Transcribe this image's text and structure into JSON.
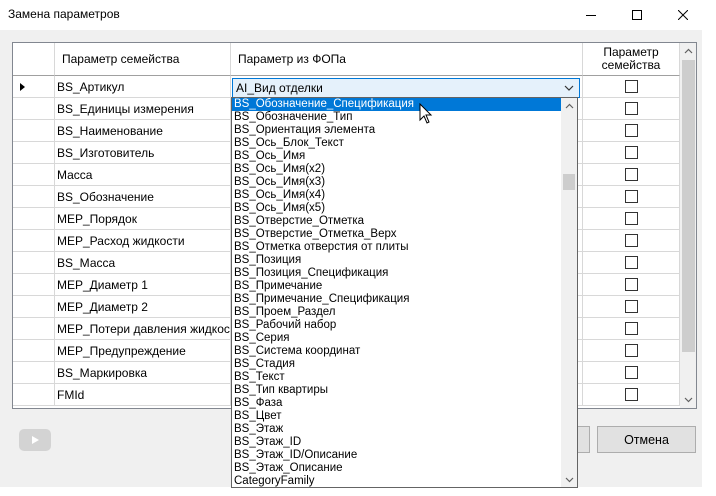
{
  "window": {
    "title": "Замена параметров"
  },
  "grid": {
    "columns": [
      "Параметр семейства",
      "Параметр из ФОПа",
      "Параметр\nсемейства"
    ],
    "rows": [
      {
        "name": "BS_Артикул",
        "fop": "AI_Вид отделки",
        "checked": false
      },
      {
        "name": "BS_Единицы измерения",
        "fop": "",
        "checked": false
      },
      {
        "name": "BS_Наименование",
        "fop": "",
        "checked": false
      },
      {
        "name": "BS_Изготовитель",
        "fop": "",
        "checked": false
      },
      {
        "name": "Масса",
        "fop": "",
        "checked": false
      },
      {
        "name": "BS_Обозначение",
        "fop": "",
        "checked": false
      },
      {
        "name": "MEP_Порядок",
        "fop": "",
        "checked": false
      },
      {
        "name": "MEP_Расход жидкости",
        "fop": "",
        "checked": false
      },
      {
        "name": "BS_Масса",
        "fop": "",
        "checked": false
      },
      {
        "name": "MEP_Диаметр 1",
        "fop": "",
        "checked": false
      },
      {
        "name": "MEP_Диаметр 2",
        "fop": "",
        "checked": false
      },
      {
        "name": "MEP_Потери давления жидкости",
        "fop": "",
        "checked": false
      },
      {
        "name": "MEP_Предупреждение",
        "fop": "",
        "checked": false
      },
      {
        "name": "BS_Маркировка",
        "fop": "",
        "checked": false
      },
      {
        "name": "FMId",
        "fop": "",
        "checked": false
      }
    ]
  },
  "combo": {
    "value": "AI_Вид отделки"
  },
  "dropdown": {
    "selected_index": 0,
    "items": [
      "BS_Обозначение_Спецификация",
      "BS_Обозначение_Тип",
      "BS_Ориентация элемента",
      "BS_Ось_Блок_Текст",
      "BS_Ось_Имя",
      "BS_Ось_Имя(x2)",
      "BS_Ось_Имя(x3)",
      "BS_Ось_Имя(x4)",
      "BS_Ось_Имя(x5)",
      "BS_Отверстие_Отметка",
      "BS_Отверстие_Отметка_Верх",
      "BS_Отметка отверстия от плиты",
      "BS_Позиция",
      "BS_Позиция_Спецификация",
      "BS_Примечание",
      "BS_Примечание_Спецификация",
      "BS_Проем_Раздел",
      "BS_Рабочий набор",
      "BS_Серия",
      "BS_Система координат",
      "BS_Стадия",
      "BS_Текст",
      "BS_Тип квартиры",
      "BS_Фаза",
      "BS_Цвет",
      "BS_Этаж",
      "BS_Этаж_ID",
      "BS_Этаж_ID/Описание",
      "BS_Этаж_Описание",
      "CategoryFamily"
    ]
  },
  "buttons": {
    "cancel_label": "Отмена"
  },
  "icons": {
    "minimize": "minimize-icon",
    "maximize": "maximize-icon",
    "close": "close-icon",
    "row_indicator": "row-indicator-icon",
    "play": "play-icon",
    "cursor": "mouse-cursor-icon"
  },
  "colors": {
    "selection": "#0078d7",
    "combo_background": "#e5f1fb"
  }
}
